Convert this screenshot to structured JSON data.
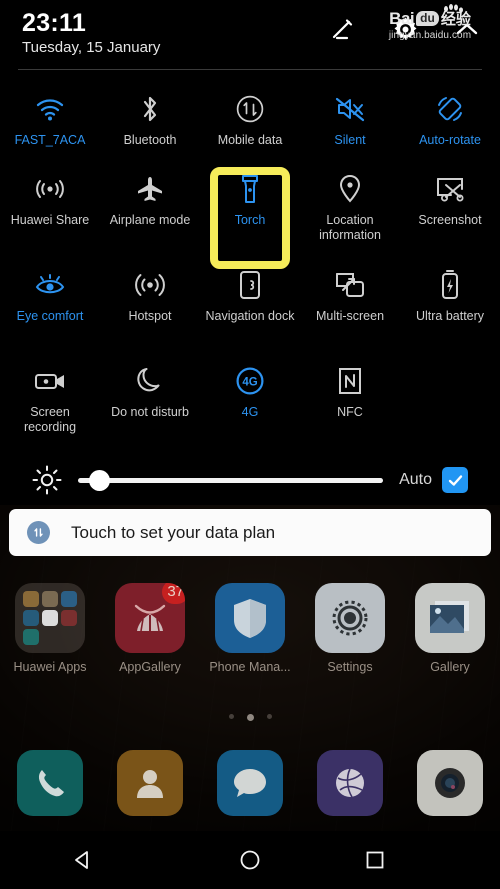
{
  "status": {
    "time": "23:11",
    "date": "Tuesday, 15 January"
  },
  "header": {
    "edit_icon": "pencil-icon",
    "settings_icon": "gear-icon",
    "collapse_icon": "chevron-up-icon"
  },
  "accent_colors": {
    "active_blue": "#2d93f0",
    "highlight_yellow": "#f6ec5a",
    "checkbox_blue": "#2196f3",
    "badge_red": "#c62020"
  },
  "tiles": [
    [
      {
        "label": "FAST_7ACA",
        "icon": "wifi-icon",
        "active": true
      },
      {
        "label": "Bluetooth",
        "icon": "bluetooth-icon",
        "active": false
      },
      {
        "label": "Mobile data",
        "icon": "mobile-data-icon",
        "active": false
      },
      {
        "label": "Silent",
        "icon": "silent-icon",
        "active": true
      },
      {
        "label": "Auto-rotate",
        "icon": "auto-rotate-icon",
        "active": true
      }
    ],
    [
      {
        "label": "Huawei Share",
        "icon": "huawei-share-icon",
        "active": false
      },
      {
        "label": "Airplane mode",
        "icon": "airplane-icon",
        "active": false
      },
      {
        "label": "Torch",
        "icon": "torch-icon",
        "active": true,
        "highlighted": true
      },
      {
        "label": "Location information",
        "icon": "location-pin-icon",
        "active": false
      },
      {
        "label": "Screenshot",
        "icon": "screenshot-icon",
        "active": false
      }
    ],
    [
      {
        "label": "Eye comfort",
        "icon": "eye-comfort-icon",
        "active": true
      },
      {
        "label": "Hotspot",
        "icon": "hotspot-icon",
        "active": false
      },
      {
        "label": "Navigation dock",
        "icon": "navigation-dock-icon",
        "active": false
      },
      {
        "label": "Multi-screen",
        "icon": "multi-screen-icon",
        "active": false
      },
      {
        "label": "Ultra battery",
        "icon": "ultra-battery-icon",
        "active": false
      }
    ],
    [
      {
        "label": "Screen recording",
        "icon": "screen-recording-icon",
        "active": false
      },
      {
        "label": "Do not disturb",
        "icon": "do-not-disturb-icon",
        "active": false
      },
      {
        "label": "4G",
        "icon": "network-4g-icon",
        "active": true
      },
      {
        "label": "NFC",
        "icon": "nfc-icon",
        "active": false
      },
      {
        "label": "",
        "icon": "",
        "active": false
      }
    ]
  ],
  "brightness": {
    "icon": "brightness-sun-icon",
    "value_percent": 4,
    "auto_label": "Auto",
    "auto_checked": true
  },
  "notification": {
    "icon": "data-plan-icon",
    "text": "Touch to set your data plan"
  },
  "apps": [
    {
      "label": "Huawei Apps",
      "icon": "folder-icon"
    },
    {
      "label": "AppGallery",
      "icon": "appgallery-icon",
      "badge": "37"
    },
    {
      "label": "Phone Mana...",
      "icon": "phone-manager-icon"
    },
    {
      "label": "Settings",
      "icon": "settings-gear-icon"
    },
    {
      "label": "Gallery",
      "icon": "gallery-icon"
    }
  ],
  "page_indicator": {
    "total": 3,
    "active_index": 1
  },
  "dock": [
    {
      "name": "Phone",
      "icon": "phone-icon"
    },
    {
      "name": "Contacts",
      "icon": "contacts-icon"
    },
    {
      "name": "Messages",
      "icon": "messages-icon"
    },
    {
      "name": "Browser",
      "icon": "browser-icon"
    },
    {
      "name": "Camera",
      "icon": "camera-icon"
    }
  ],
  "nav_bar": {
    "back": "back-triangle-icon",
    "home": "home-circle-icon",
    "recents": "recents-square-icon"
  },
  "watermark": {
    "brand": "Bai",
    "brand_mid": "du",
    "brand_cn": "经验",
    "url": "jingyan.baidu.com"
  }
}
